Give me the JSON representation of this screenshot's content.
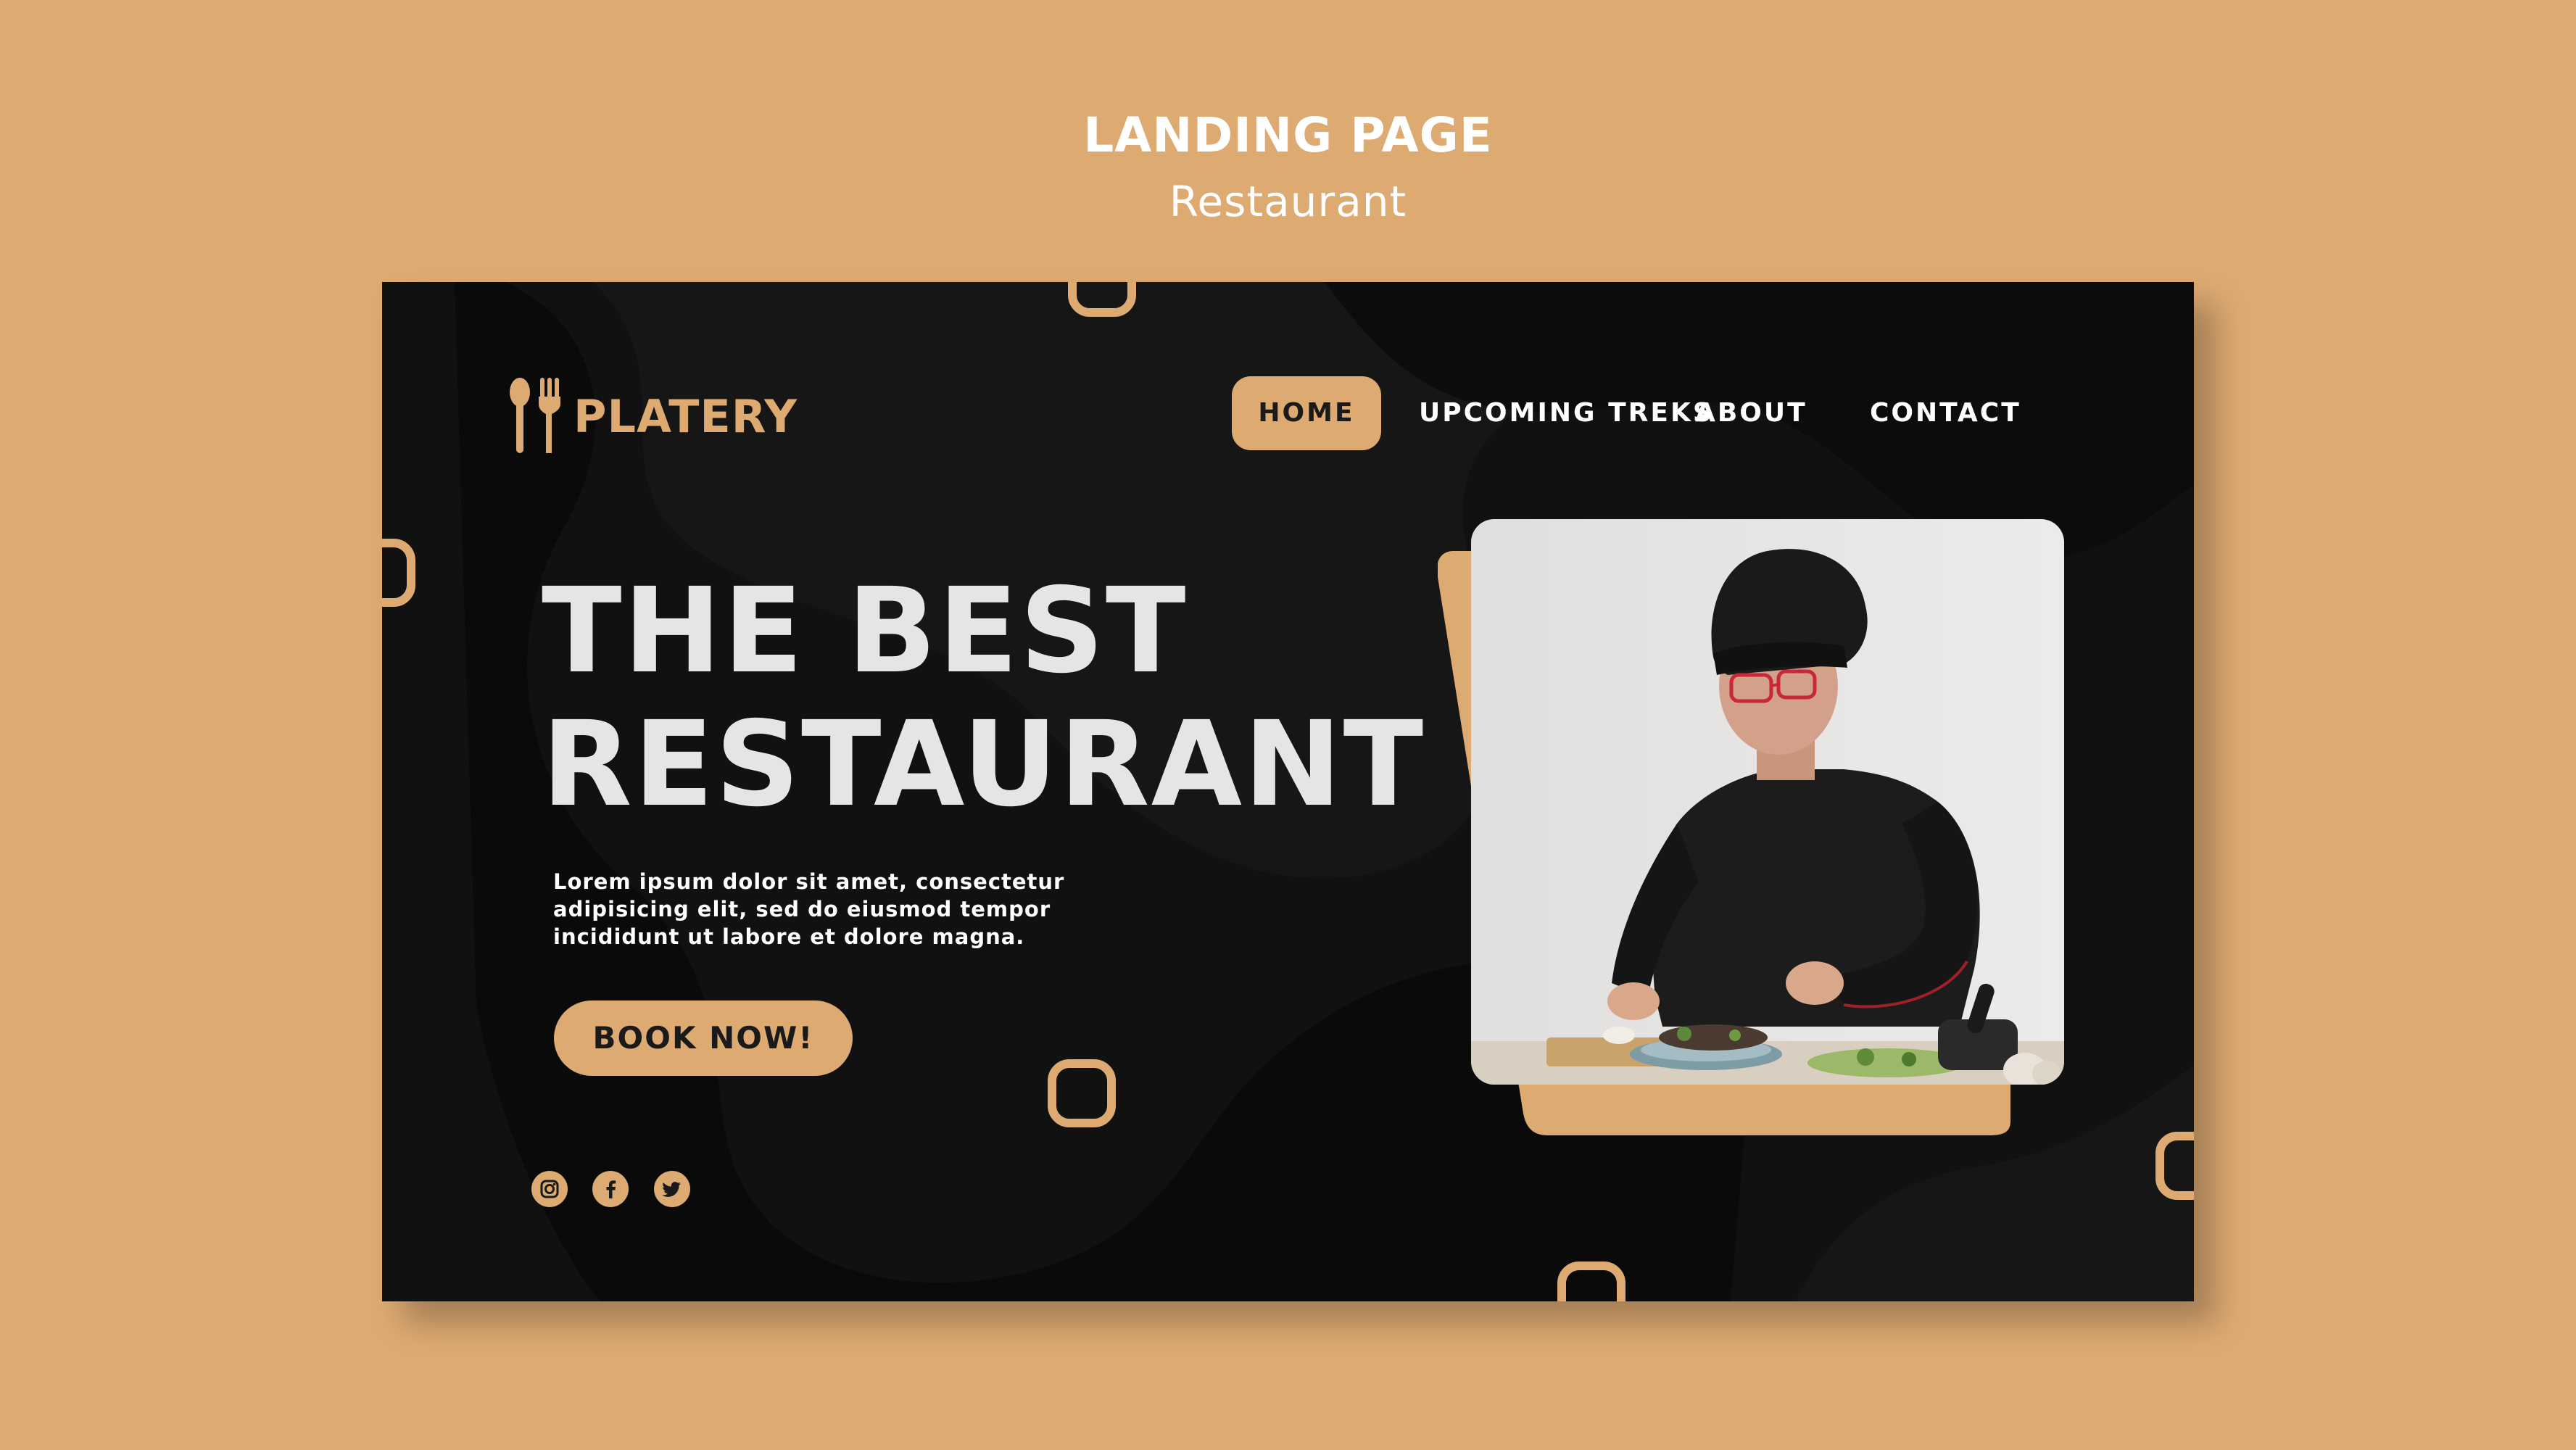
{
  "header": {
    "title": "LANDING PAGE",
    "subtitle": "Restaurant"
  },
  "brand": {
    "name": "PLATERY",
    "logo_icon": "spoon-fork-icon"
  },
  "nav": {
    "items": [
      {
        "label": "HOME",
        "active": true
      },
      {
        "label": "UPCOMING TREKS",
        "active": false
      },
      {
        "label": "ABOUT",
        "active": false
      },
      {
        "label": "CONTACT",
        "active": false
      }
    ]
  },
  "hero": {
    "title_line1": "THE BEST",
    "title_line2": "RESTAURANT",
    "description_line1": "Lorem ipsum dolor sit amet, consectetur",
    "description_line2": "adipisicing elit, sed do eiusmod tempor",
    "description_line3": "incididunt ut labore et dolore magna.",
    "cta_label": "BOOK NOW!"
  },
  "socials": [
    {
      "icon": "instagram-icon"
    },
    {
      "icon": "facebook-icon"
    },
    {
      "icon": "twitter-icon"
    }
  ],
  "photo": {
    "subject": "chef-plating-food-image"
  },
  "colors": {
    "background": "#DDAA72",
    "panel": "#111111",
    "accent": "#DDAA72",
    "hero_text": "#E5E5E5"
  }
}
